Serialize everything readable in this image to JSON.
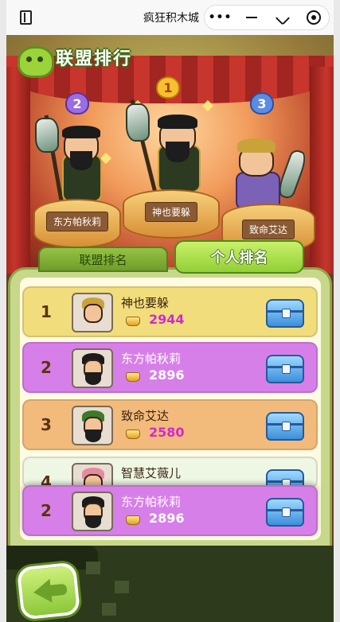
{
  "topbar": {
    "title": "疯狂积木城",
    "more_glyph": "•••"
  },
  "header": {
    "title": "联盟排行"
  },
  "podium": [
    {
      "rank": "2",
      "name": "东方帕秋莉"
    },
    {
      "rank": "1",
      "name": "神也要躲"
    },
    {
      "rank": "3",
      "name": "致命艾达"
    }
  ],
  "tabs": {
    "alliance": "联盟排名",
    "personal": "个人排名"
  },
  "rows": [
    {
      "rank": "1",
      "name": "神也要躲",
      "score": "2944"
    },
    {
      "rank": "2",
      "name": "东方帕秋莉",
      "score": "2896"
    },
    {
      "rank": "3",
      "name": "致命艾达",
      "score": "2580"
    },
    {
      "rank": "4",
      "name": "智慧艾薇儿",
      "score": ""
    }
  ],
  "self_row": {
    "rank": "2",
    "name": "东方帕秋莉",
    "score": "2896"
  },
  "colors": {
    "accent_green": "#92cf35",
    "row_gold": "#f2dd7d",
    "row_purple": "#d77fe8",
    "row_orange": "#f2bb7c",
    "score_magenta": "#cf2ad0"
  },
  "icons": [
    "sidebar-icon",
    "more-icon",
    "minimize-icon",
    "restore-icon",
    "close-target-icon",
    "gold-icon",
    "chest-icon",
    "back-arrow-icon"
  ]
}
